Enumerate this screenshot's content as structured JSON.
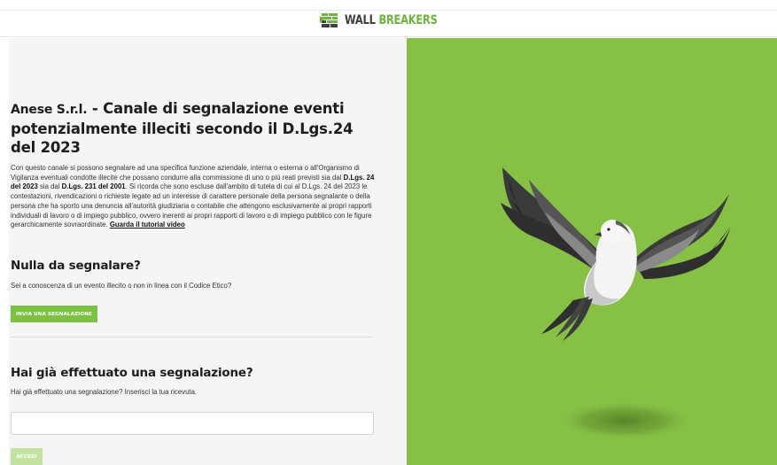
{
  "header": {
    "brand_part1": "WALL",
    "brand_part2": "BREAKERS"
  },
  "main": {
    "title_company": "Anese S.r.l.",
    "title_rest": "- Canale di segnalazione eventi potenzialmente illeciti secondo il D.Lgs.24 del 2023",
    "intro": {
      "p1": "Con questo canale si possono segnalare ad una specifica funzione aziendale, interna o esterna o all'Organismo di Vigilanza eventuali condotte illecite che possano condurre alla commissione di uno o più reati previsti sia dal",
      "law1": "D.Lgs. 24 del 2023",
      "p2": "sia dal",
      "law2": "D.Lgs. 231 del 2001",
      "p3": ". Si ricorda che sono escluse dall'ambito di tutela di cui al D.Lgs. 24 del 2023 le contestazioni, rivendicazioni o richieste legate ad un interesse di carattere personale della persona segnalante o della persona che ha sporto una denuncia all'autorità giudiziaria o contabile che attengono esclusivamente ai propri rapporti individuali di lavoro o di impiego pubblico, ovvero inerenti ai propri rapporti di lavoro o di impiego pubblico con le figure gerarchicamente sovraordinate.",
      "tutorial_link": "Guarda il tutorial video"
    }
  },
  "report_section": {
    "title": "Nulla da segnalare?",
    "subtitle": "Sei a conoscenza di un evento illecito o non in linea con il Codice Etico?",
    "button_label": "INVIA UNA SEGNALAZIONE"
  },
  "receipt_section": {
    "title": "Hai già effettuato una segnalazione?",
    "subtitle": "Hai già effettuato una segnalazione? Inserisci la tua ricevuta.",
    "input_value": "",
    "button_label": "ACCEDI"
  },
  "colors": {
    "brand_green": "#7dc142",
    "panel_green": "#86c146",
    "button_disabled": "#c3e29f",
    "text_dark": "#1d1d1d"
  },
  "illustration": {
    "icon": "dove-icon"
  }
}
